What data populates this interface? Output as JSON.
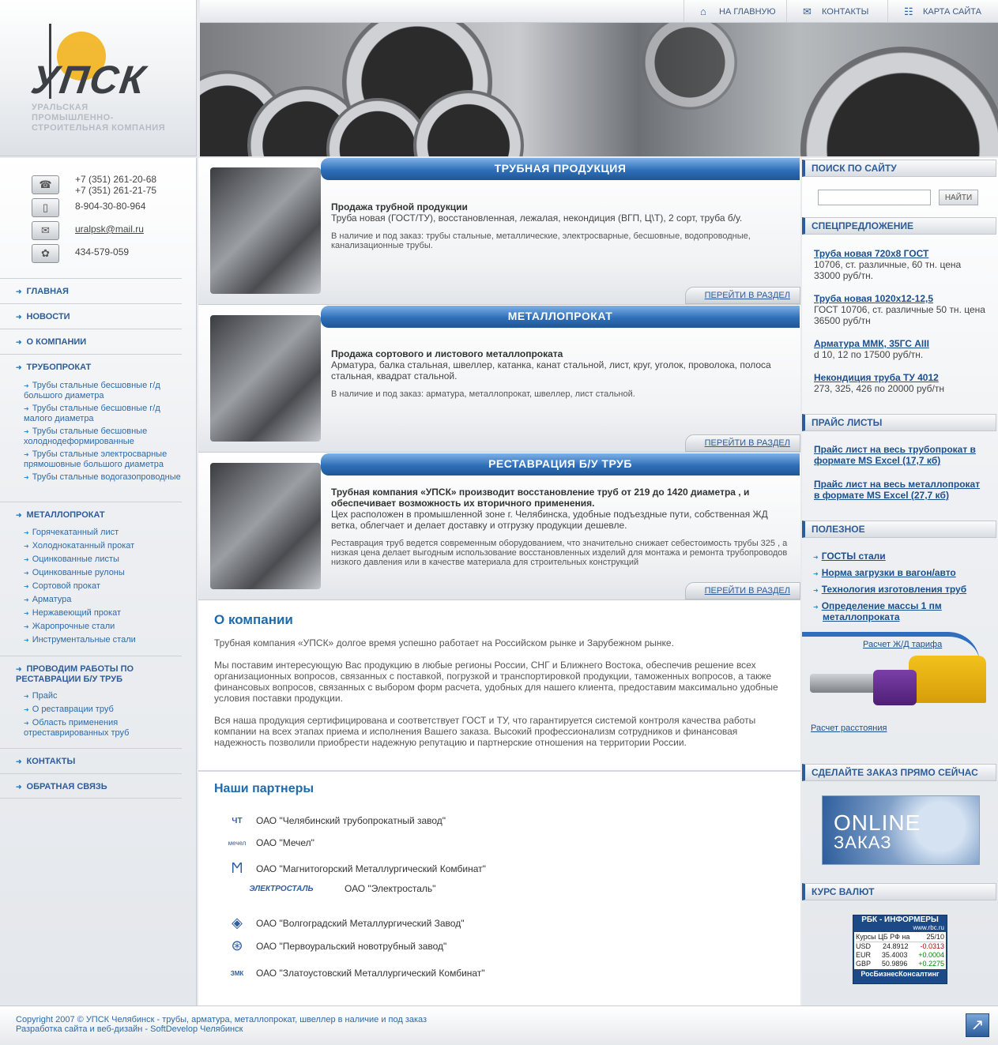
{
  "brand": {
    "logo_text": "УПСК",
    "tagline": "УРАЛЬСКАЯ ПРОМЫШЛЕННО-СТРОИТЕЛЬНАЯ КОМПАНИЯ"
  },
  "topnav": [
    {
      "label": "НА ГЛАВНУЮ",
      "icon": "home-icon"
    },
    {
      "label": "КОНТАКТЫ",
      "icon": "mail-icon"
    },
    {
      "label": "КАРТА САЙТА",
      "icon": "sitemap-icon"
    }
  ],
  "contacts": {
    "phone1": "+7 (351) 261-20-68",
    "phone2": "+7 (351) 261-21-75",
    "mobile": "8-904-30-80-964",
    "email": "uralpsk@mail.ru",
    "icq": "434-579-059"
  },
  "menu": {
    "main": "ГЛАВНАЯ",
    "news": "НОВОСТИ",
    "about": "О КОМПАНИИ",
    "pipes": "ТРУБОПРОКАТ",
    "pipes_sub": [
      "Трубы стальные бесшовные г/д большого диаметра",
      "Трубы стальные бесшовные г/д малого диаметра",
      "Трубы стальные бесшовные холоднодеформированные",
      "Трубы стальные электросварные прямошовные большого диаметра",
      "Трубы стальные водогазопроводные"
    ],
    "metal": "МЕТАЛЛОПРОКАТ",
    "metal_sub": [
      "Горячекатанный лист",
      "Холоднокатанный прокат",
      "Оцинкованные листы",
      "Оцинкованные рулоны",
      "Сортовой прокат",
      "Арматура",
      "Нержавеющий прокат",
      "Жаропрочные стали",
      "Инструментальные стали"
    ],
    "restore": "ПРОВОДИМ РАБОТЫ ПО РЕСТАВРАЦИИ Б/У ТРУБ",
    "restore_sub": [
      "Прайс",
      "О реставрации труб",
      "Область применения отреставрированных труб"
    ],
    "contacts": "КОНТАКТЫ",
    "feedback": "ОБРАТНАЯ СВЯЗЬ"
  },
  "sections": [
    {
      "header": "ТРУБНАЯ ПРОДУКЦИЯ",
      "title": "Продажа трубной продукции",
      "desc": "Труба новая (ГОСТ/ТУ), восстановленная, лежалая, некондиция (ВГП, Ц\\Т), 2 сорт, труба б/у.",
      "note": "В наличие и под заказ: трубы стальные, металлические, электросварные, бесшовные, водопроводные, канализационные трубы.",
      "link": "ПЕРЕЙТИ В РАЗДЕЛ"
    },
    {
      "header": "МЕТАЛЛОПРОКАТ",
      "title": "Продажа сортового и листового металлопроката",
      "desc": "Арматура, балка стальная, швеллер, катанка, канат стальной, лист, круг, уголок, проволока, полоса стальная, квадрат стальной.",
      "note": "В наличие и под заказ: арматура, металлопрокат, швеллер, лист стальной.",
      "link": "ПЕРЕЙТИ В РАЗДЕЛ"
    },
    {
      "header": "РЕСТАВРАЦИЯ Б/У ТРУБ",
      "title": "Трубная компания «УПСК» производит восстановление труб от 219 до 1420 диаметра , и обеспечивает возможность их вторичного применения.",
      "desc": "Цех расположен в промышленной зоне г. Челябинска, удобные подъездные пути, собственная ЖД ветка, облегчает и делает доставку и отгрузку продукции дешевле.",
      "note": "Реставрация труб ведется современным оборудованием, что значительно снижает себестоимость трубы 325 , а низкая цена делает выгодным использование восстановленных изделий для монтажа и ремонта трубопроводов низкого давления или в качестве материала для строительных конструкций",
      "link": "ПЕРЕЙТИ В РАЗДЕЛ"
    }
  ],
  "about": {
    "title": "О компании",
    "p1": "Трубная компания «УПСК» долгое время успешно работает на Российском рынке и Зарубежном рынке.",
    "p2": "Мы поставим интересующую Вас продукцию в любые регионы России, СНГ и Ближнего Востока, обеспечив решение всех организационных вопросов, связанных с поставкой, погрузкой и транспортировкой продукции, таможенных вопросов, а также финансовых вопросов, связанных с выбором форм расчета, удобных для нашего клиента, предоставим максимально удобные условия поставки продукции.",
    "p3": "Вся наша продукция сертифицирована и соответствует ГОСТ и ТУ, что гарантируется системой контроля качества работы компании на всех этапах приема и исполнения Вашего заказа. Высокий профессионализм сотрудников и финансовая надежность позволили приобрести надежную репутацию и партнерские отношения на территории России."
  },
  "partners": {
    "title": "Наши партнеры",
    "items": [
      "ОАО \"Челябинский трубопрокатный завод\"",
      "ОАО \"Мечел\"",
      "ОАО \"Магнитогорский Металлургический Комбинат\"",
      "ОАО \"Электросталь\"",
      "ОАО \"Волгоградский Металлургический Завод\"",
      "ОАО \"Первоуральский новотрубный завод\"",
      "ОАО \"Златоустовский Металлургический Комбинат\""
    ],
    "logo_text": {
      "p0": "ЧТ",
      "p1": "мечел",
      "p3": "ЭЛЕКТРОСТАЛЬ",
      "p6": "ЗМК"
    }
  },
  "right": {
    "search_title": "ПОИСК ПО САЙТУ",
    "search_button": "НАЙТИ",
    "special_title": "СПЕЦПРЕДЛОЖЕНИЕ",
    "offers": [
      {
        "name": "Труба новая 720х8 ГОСТ",
        "desc": "10706, ст. различные, 60 тн. цена 33000 руб/тн."
      },
      {
        "name": "Труба новая 1020х12-12,5",
        "desc": "ГОСТ 10706, ст. различные 50 тн. цена 36500 руб/тн"
      },
      {
        "name": "Арматура ММК, 35ГС AIII",
        "desc": "d 10, 12 по 17500 руб/тн."
      },
      {
        "name": "Некондиция труба ТУ 4012",
        "desc": "273, 325, 426 по 20000 руб/тн"
      }
    ],
    "price_title": "ПРАЙС ЛИСТЫ",
    "prices": [
      "Прайс лист на весь трубопрокат в формате MS Excel (17,7 кб)",
      "Прайс лист на весь металлопрокат в формате MS Excel (27,7 кб)"
    ],
    "useful_title": "ПОЛЕЗНОЕ",
    "useful": [
      "ГОСТЫ стали",
      "Норма загрузки в вагон/авто",
      "Технология изготовления труб",
      "Определение массы 1 пм металлопроката"
    ],
    "rail_calc": "Расчет Ж/Д тарифа",
    "dist_calc": "Расчет расстояния",
    "order_title": "СДЕЛАЙТЕ ЗАКАЗ ПРЯМО СЕЙЧАС",
    "online1": "ONLINE",
    "online2": "ЗАКАЗ",
    "currency_title": "КУРС ВАЛЮТ",
    "informer": {
      "header": "РБК - ИНФОРМЕРЫ",
      "site": "www.rbc.ru",
      "caption": "Курсы ЦБ РФ на",
      "date": "25/10",
      "rows": [
        {
          "cur": "USD",
          "val": "24.8912",
          "chg": "-0.0313"
        },
        {
          "cur": "EUR",
          "val": "35.4003",
          "chg": "+0.0004"
        },
        {
          "cur": "GBP",
          "val": "50.9896",
          "chg": "+0.2275"
        }
      ],
      "footer": "РосБизнесКонсалтинг"
    }
  },
  "footer": {
    "line1": "Copyright 2007 © УПСК Челябинск - трубы, арматура, металлопрокат, швеллер в наличие и под заказ",
    "line2": "Разработка сайта и веб-дизайн - SoftDevelop Челябинск"
  }
}
